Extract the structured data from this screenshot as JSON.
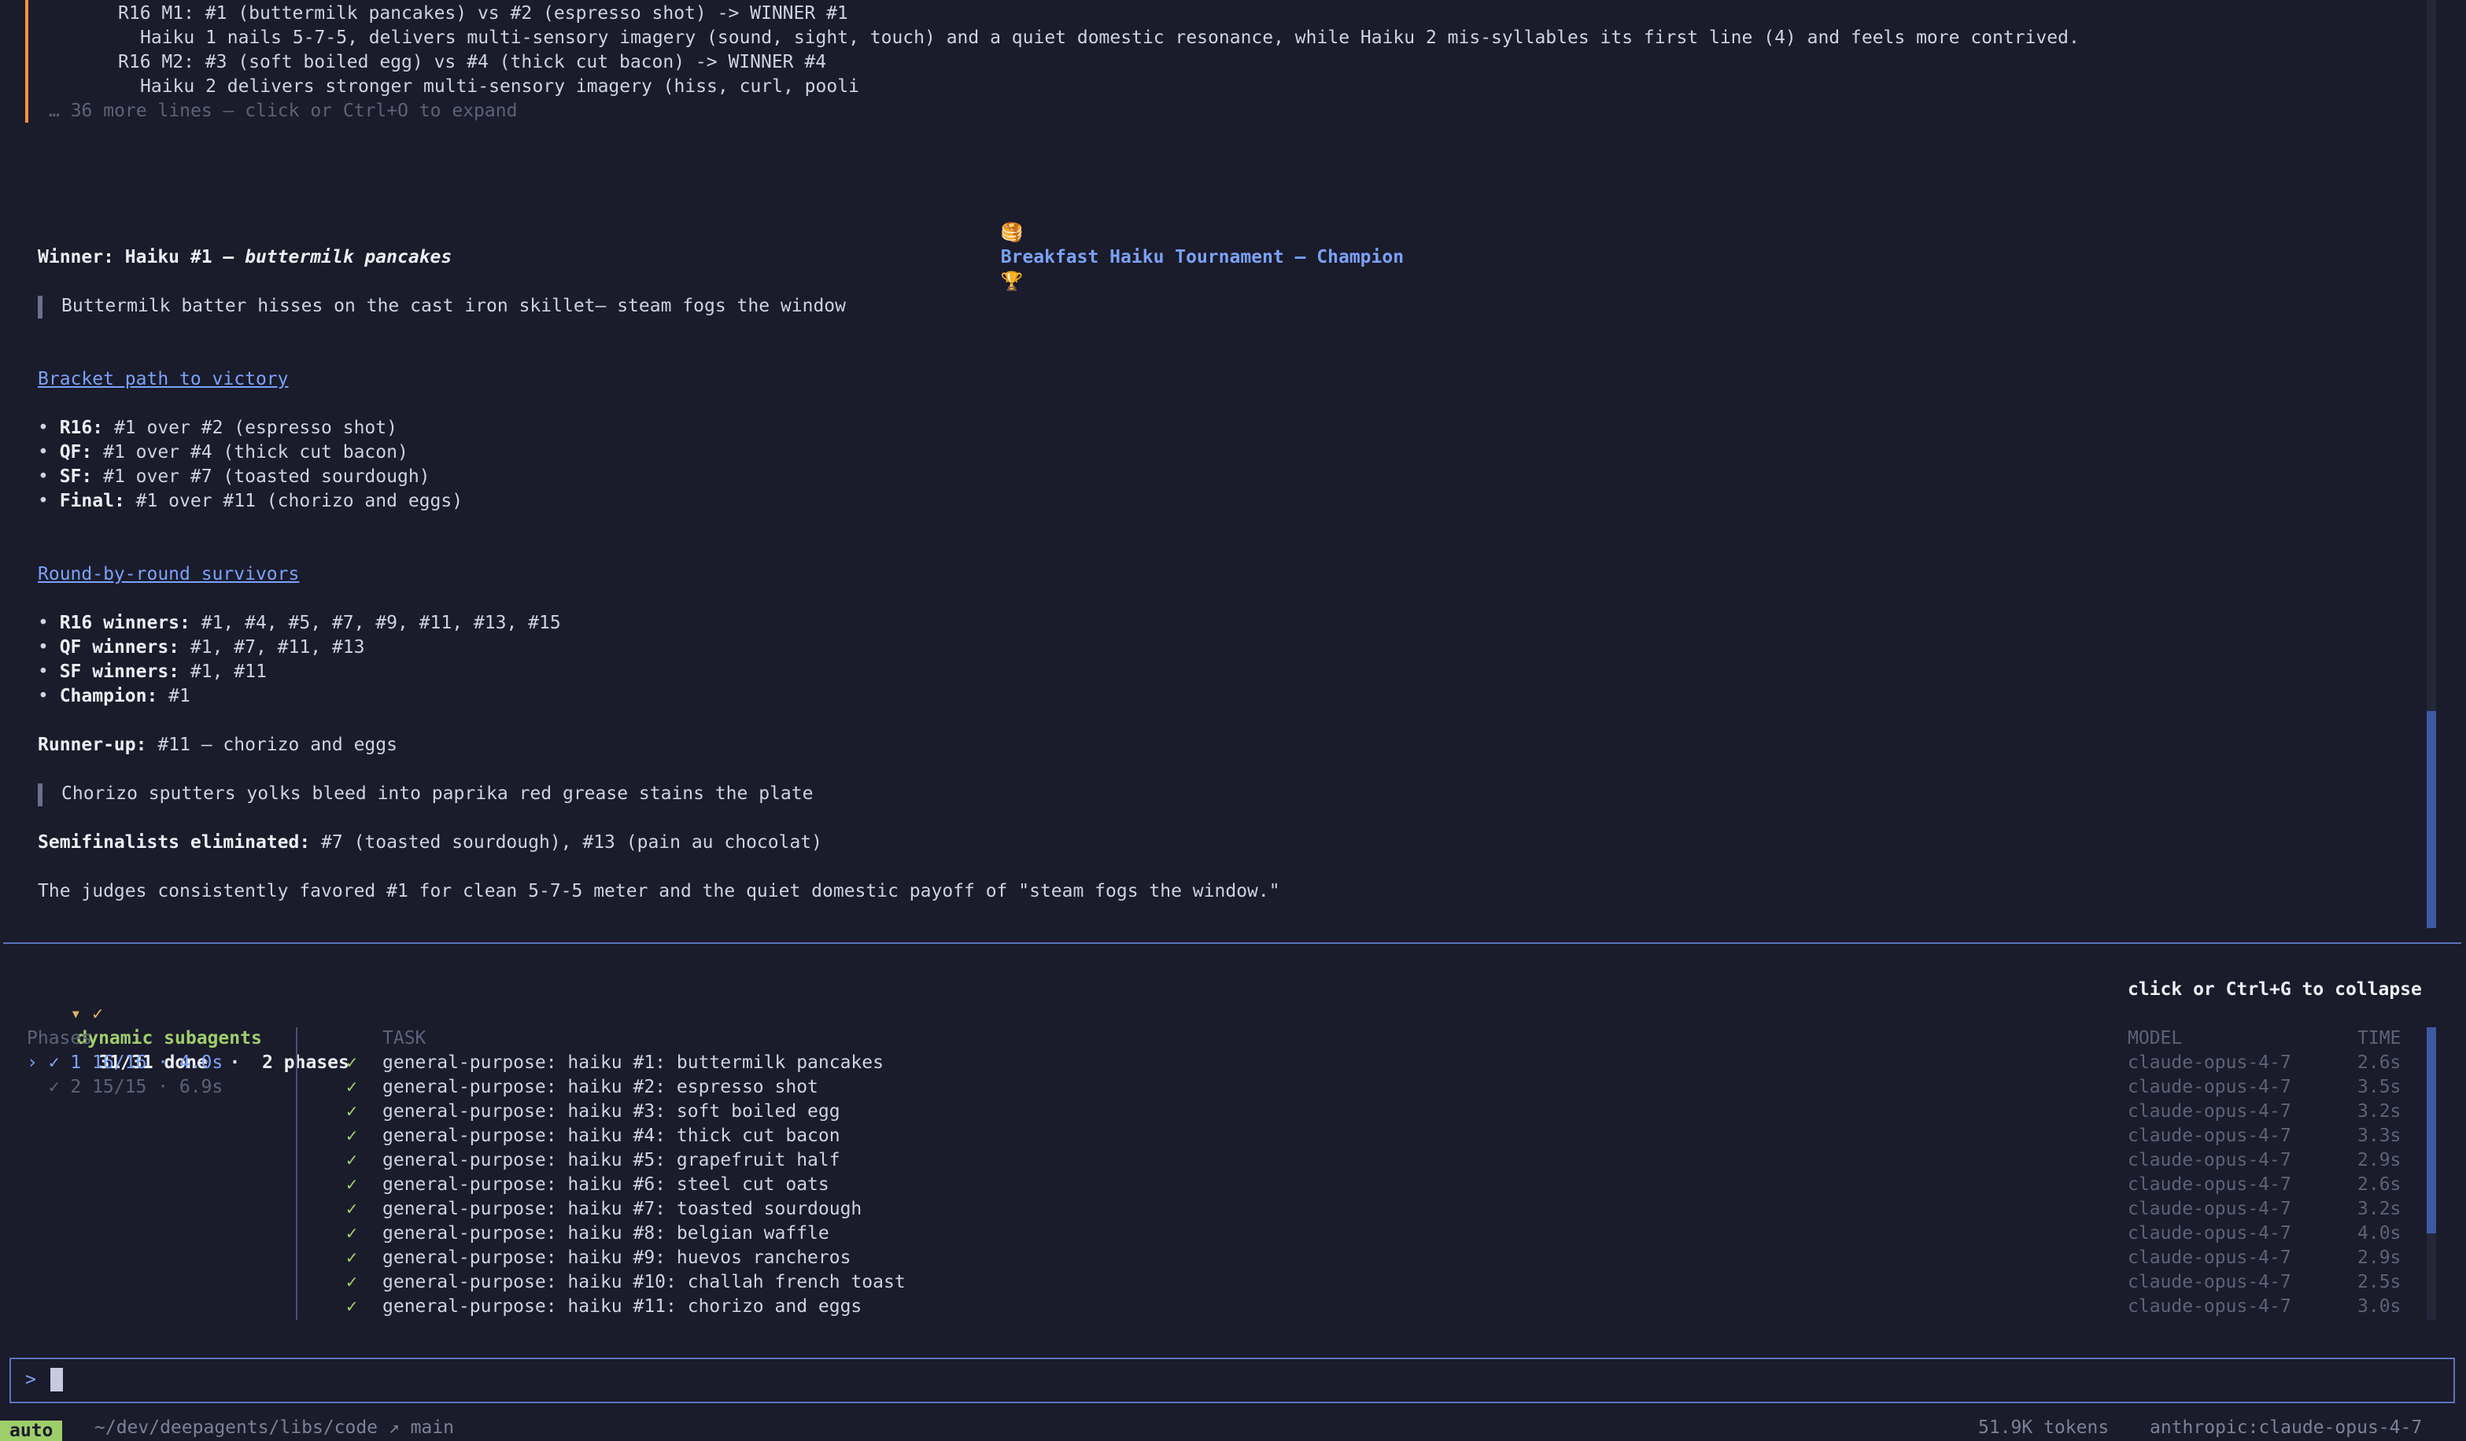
{
  "log": {
    "lines": [
      "R16 M1: #1 (buttermilk pancakes) vs #2 (espresso shot) -> WINNER #1",
      "Haiku 1 nails 5-7-5, delivers multi-sensory imagery (sound, sight, touch) and a quiet domestic resonance, while Haiku 2 mis-syllables its first line (4) and feels more contrived.",
      "R16 M2: #3 (soft boiled egg) vs #4 (thick cut bacon) -> WINNER #4",
      "Haiku 2 delivers stronger multi-sensory imagery (hiss, curl, pooli"
    ],
    "expand_hint": "… 36 more lines — click or Ctrl+O to expand"
  },
  "result": {
    "title_icon_left": "🥞",
    "title": "Breakfast Haiku Tournament — Champion",
    "title_icon_right": "🏆",
    "winner_label": "Winner: Haiku #1 — ",
    "winner_name": "buttermilk pancakes",
    "winner_haiku": "Buttermilk batter hisses on the cast iron skillet— steam fogs the window",
    "bracket_heading": "Bracket path to victory",
    "bracket": [
      {
        "label": "R16:",
        "text": " #1 over #2 (espresso shot)"
      },
      {
        "label": "QF:",
        "text": " #1 over #4 (thick cut bacon)"
      },
      {
        "label": "SF:",
        "text": " #1 over #7 (toasted sourdough)"
      },
      {
        "label": "Final:",
        "text": " #1 over #11 (chorizo and eggs)"
      }
    ],
    "survivors_heading": "Round-by-round survivors",
    "survivors": [
      {
        "label": "R16 winners:",
        "text": " #1, #4, #5, #7, #9, #11, #13, #15"
      },
      {
        "label": "QF winners:",
        "text": " #1, #7, #11, #13"
      },
      {
        "label": "SF winners:",
        "text": " #1, #11"
      },
      {
        "label": "Champion:",
        "text": " #1"
      }
    ],
    "runnerup_label": "Runner-up:",
    "runnerup_text": " #11 — chorizo and eggs",
    "runnerup_haiku": "Chorizo sputters yolks bleed into paprika red grease stains the plate",
    "semis_label": "Semifinalists eliminated:",
    "semis_text": " #7 (toasted sourdough), #13 (pain au chocolat)",
    "summary": "The judges consistently favored #1 for clean 5-7-5 meter and the quiet domestic payoff of \"steam fogs the window.\""
  },
  "subagents": {
    "toggle": "▾ ✓",
    "title": "dynamic subagents",
    "status": "31/31 done  ·  2 phases",
    "collapse_hint": "click or Ctrl+G to collapse",
    "phases_header": "Phases",
    "phases": [
      {
        "text": "› ✓ 1 16/16 · 4.0s"
      },
      {
        "text": "  ✓ 2 15/15 · 6.9s"
      }
    ],
    "col_task": "TASK",
    "col_model": "MODEL",
    "col_time": "TIME",
    "tasks": [
      {
        "task": "general-purpose: haiku #1: buttermilk pancakes",
        "model": "claude-opus-4-7",
        "time": "2.6s"
      },
      {
        "task": "general-purpose: haiku #2: espresso shot",
        "model": "claude-opus-4-7",
        "time": "3.5s"
      },
      {
        "task": "general-purpose: haiku #3: soft boiled egg",
        "model": "claude-opus-4-7",
        "time": "3.2s"
      },
      {
        "task": "general-purpose: haiku #4: thick cut bacon",
        "model": "claude-opus-4-7",
        "time": "3.3s"
      },
      {
        "task": "general-purpose: haiku #5: grapefruit half",
        "model": "claude-opus-4-7",
        "time": "2.9s"
      },
      {
        "task": "general-purpose: haiku #6: steel cut oats",
        "model": "claude-opus-4-7",
        "time": "2.6s"
      },
      {
        "task": "general-purpose: haiku #7: toasted sourdough",
        "model": "claude-opus-4-7",
        "time": "3.2s"
      },
      {
        "task": "general-purpose: haiku #8: belgian waffle",
        "model": "claude-opus-4-7",
        "time": "4.0s"
      },
      {
        "task": "general-purpose: haiku #9: huevos rancheros",
        "model": "claude-opus-4-7",
        "time": "2.9s"
      },
      {
        "task": "general-purpose: haiku #10: challah french toast",
        "model": "claude-opus-4-7",
        "time": "2.5s"
      },
      {
        "task": "general-purpose: haiku #11: chorizo and eggs",
        "model": "claude-opus-4-7",
        "time": "3.0s"
      }
    ]
  },
  "input": {
    "prompt": ">"
  },
  "status_bar": {
    "mode": "auto",
    "path": "~/dev/deepagents/libs/code ↗ main",
    "tokens": "51.9K tokens",
    "model": "anthropic:claude-opus-4-7"
  }
}
